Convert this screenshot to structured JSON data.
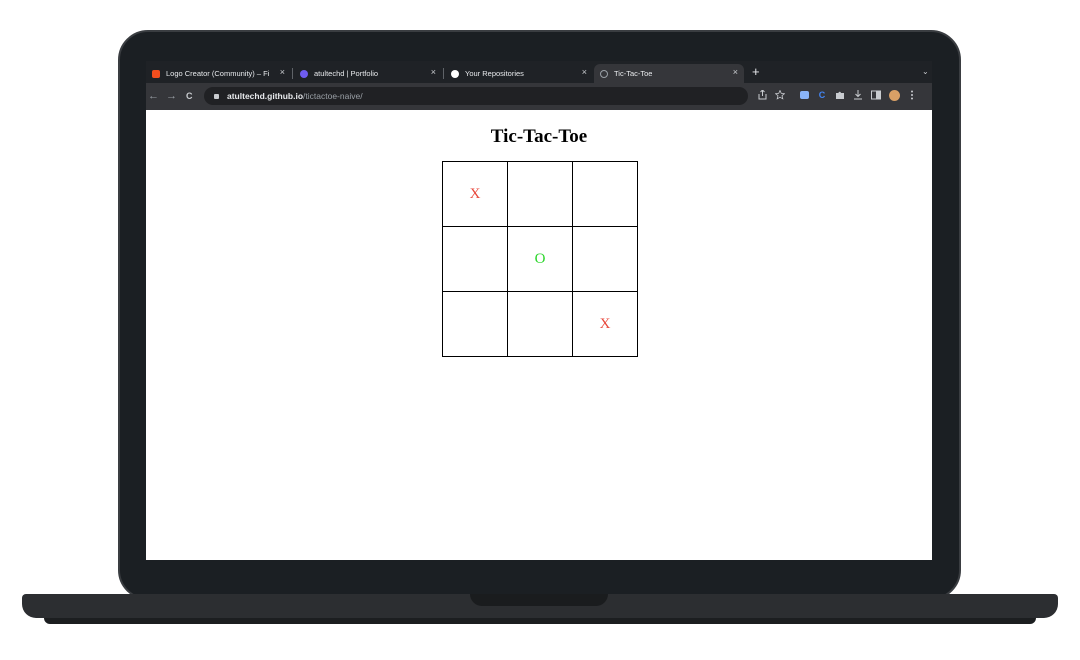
{
  "browser": {
    "tabs": [
      {
        "label": "Logo Creator (Community) – Fi",
        "favicon_color": "#f24e1e",
        "active": false
      },
      {
        "label": "atultechd | Portfolio",
        "favicon_color": "#6f5cf0",
        "active": false
      },
      {
        "label": "Your Repositories",
        "favicon_color": "#ffffff",
        "active": false
      },
      {
        "label": "Tic-Tac-Toe",
        "favicon_color": "#9aa0a6",
        "active": true
      }
    ],
    "close_glyph": "×",
    "new_tab_glyph": "+",
    "tab_menu_glyph": "⌄",
    "back_glyph": "←",
    "forward_glyph": "→",
    "reload_glyph": "C",
    "url_host": "atultechd.github.io",
    "url_path": "/tictactoe-naive/"
  },
  "page": {
    "title": "Tic-Tac-Toe",
    "board": [
      "X",
      "",
      "",
      "",
      "O",
      "",
      "",
      "",
      "X"
    ],
    "x_color": "#e8463a",
    "o_color": "#2bd62b"
  }
}
